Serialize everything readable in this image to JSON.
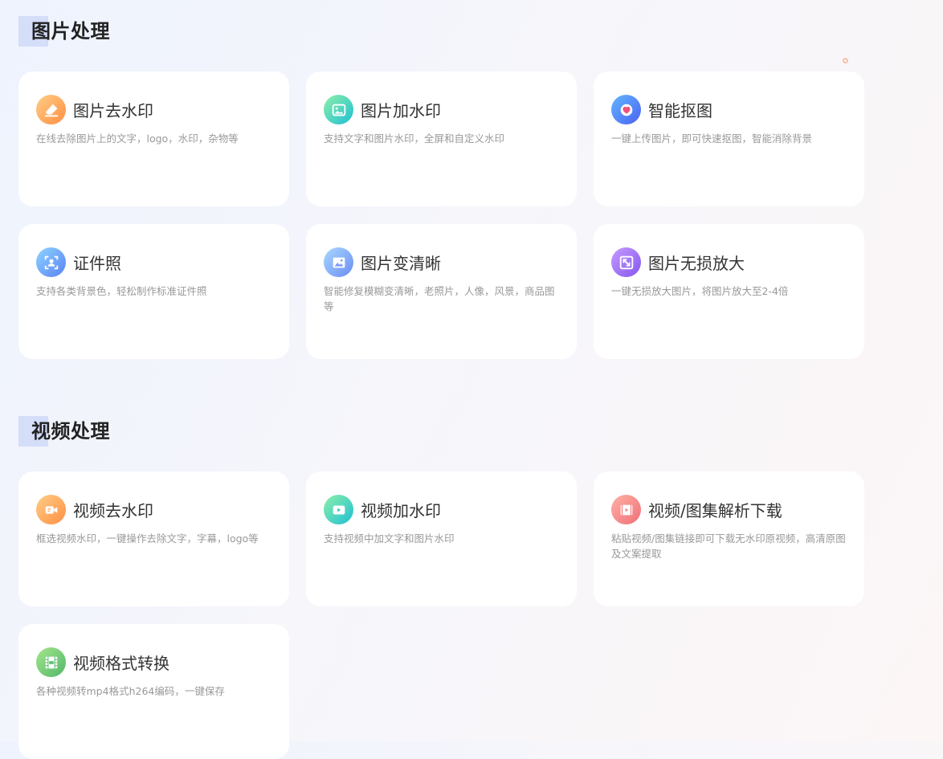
{
  "sections": [
    {
      "title": "图片处理",
      "cards": [
        {
          "icon": "eraser-icon",
          "title": "图片去水印",
          "desc": "在线去除图片上的文字，logo，水印，杂物等"
        },
        {
          "icon": "image-watermark-icon",
          "title": "图片加水印",
          "desc": "支持文字和图片水印，全屏和自定义水印"
        },
        {
          "icon": "cutout-icon",
          "title": "智能抠图",
          "desc": "一键上传图片，即可快速抠图，智能消除背景"
        },
        {
          "icon": "id-photo-icon",
          "title": "证件照",
          "desc": "支持各类背景色，轻松制作标准证件照"
        },
        {
          "icon": "enhance-image-icon",
          "title": "图片变清晰",
          "desc": "智能修复模糊变清晰，老照片，人像，风景，商品图等"
        },
        {
          "icon": "upscale-icon",
          "title": "图片无损放大",
          "desc": "一键无损放大图片，将图片放大至2-4倍"
        }
      ]
    },
    {
      "title": "视频处理",
      "cards": [
        {
          "icon": "video-camera-icon",
          "title": "视频去水印",
          "desc": "框选视频水印，一键操作去除文字，字幕，logo等"
        },
        {
          "icon": "video-play-icon",
          "title": "视频加水印",
          "desc": "支持视频中加文字和图片水印"
        },
        {
          "icon": "film-download-icon",
          "title": "视频/图集解析下载",
          "desc": "粘贴视频/图集链接即可下载无水印原视频，高清原图及文案提取"
        },
        {
          "icon": "mp4-film-icon",
          "title": "视频格式转换",
          "desc": "各种视频转mp4格式h264编码，一键保存"
        }
      ]
    }
  ]
}
